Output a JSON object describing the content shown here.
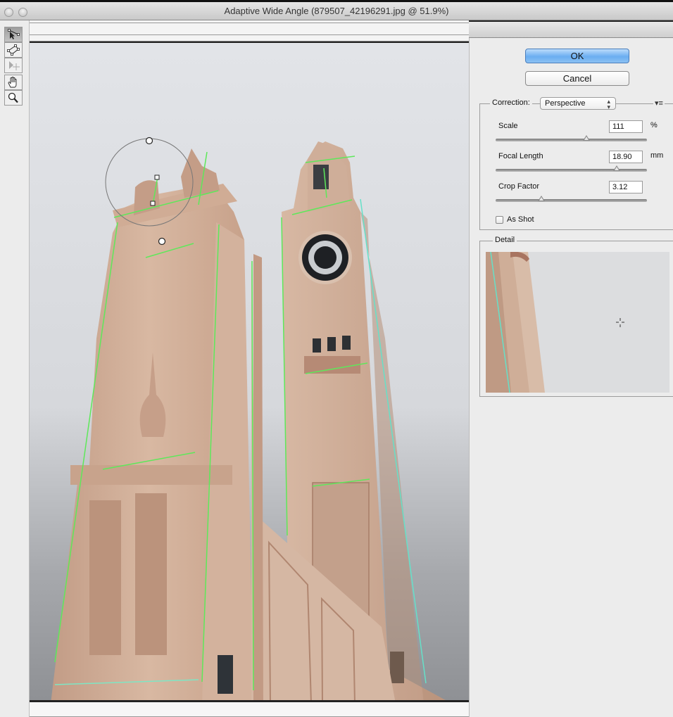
{
  "window": {
    "title": "Adaptive Wide Angle (879507_42196291.jpg @ 51.9%)"
  },
  "tools": [
    {
      "name": "constraint-tool",
      "active": true
    },
    {
      "name": "polygon-constraint-tool",
      "active": false
    },
    {
      "name": "move-tool",
      "active": false
    },
    {
      "name": "hand-tool",
      "active": false
    },
    {
      "name": "zoom-tool",
      "active": false
    }
  ],
  "buttons": {
    "ok": "OK",
    "cancel": "Cancel"
  },
  "correction": {
    "label": "Correction:",
    "selected": "Perspective",
    "flyout_icon": "▾≡"
  },
  "fields": {
    "scale": {
      "label": "Scale",
      "value": "111",
      "unit": "%",
      "slider_fraction": 0.6
    },
    "focal_length": {
      "label": "Focal Length",
      "value": "18.90",
      "unit": "mm",
      "slider_fraction": 0.8
    },
    "crop_factor": {
      "label": "Crop Factor",
      "value": "3.12",
      "unit": "",
      "slider_fraction": 0.3
    }
  },
  "as_shot": {
    "label": "As Shot",
    "checked": false
  },
  "detail": {
    "label": "Detail"
  },
  "colors": {
    "constraint_line": "#5ee85a",
    "constraint_line_alt": "#66e0c8",
    "ok_button": "#6aaef1"
  }
}
